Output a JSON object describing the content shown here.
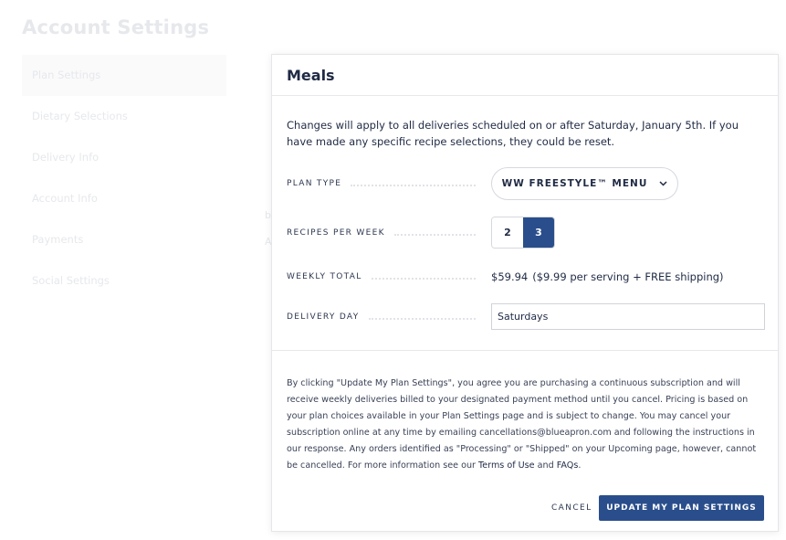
{
  "page": {
    "title": "Account Settings",
    "nav": [
      {
        "label": "Plan Settings",
        "active": true
      },
      {
        "label": "Dietary Selections",
        "active": false
      },
      {
        "label": "Delivery Info",
        "active": false
      },
      {
        "label": "Account Info",
        "active": false
      },
      {
        "label": "Payments",
        "active": false
      },
      {
        "label": "Social Settings",
        "active": false
      }
    ],
    "ghost_text": [
      "b",
      "A"
    ]
  },
  "modal": {
    "title": "Meals",
    "intro": "Changes will apply to all deliveries scheduled on or after Saturday, January 5th. If you have made any specific recipe selections, they could be reset.",
    "plan_type": {
      "label": "PLAN TYPE",
      "value": "WW FREESTYLE™ MENU",
      "icon": "chevron-down-icon"
    },
    "recipes_per_week": {
      "label": "RECIPES PER WEEK",
      "options": [
        "2",
        "3"
      ],
      "selected": "3"
    },
    "weekly_total": {
      "label": "WEEKLY TOTAL",
      "price": "$59.94",
      "detail": "($9.99 per serving + FREE shipping)"
    },
    "delivery_day": {
      "label": "DELIVERY DAY",
      "value": "Saturdays"
    },
    "legal": {
      "text": "By clicking \"Update My Plan Settings\", you agree you are purchasing a continuous subscription and will receive weekly deliveries billed to your designated payment method until you cancel. Pricing is based on your plan choices available in your Plan Settings page and is subject to change. You may cancel your subscription online at any time by emailing cancellations@blueapron.com and following the instructions in our response. Any orders identified as \"Processing\" or \"Shipped\" on your Upcoming page, however, cannot be cancelled. For more information see our ",
      "terms_link": "Terms of Use",
      "and": " and ",
      "faqs_link": "FAQs",
      "end": "."
    },
    "cancel_label": "CANCEL",
    "update_label": "UPDATE MY PLAN SETTINGS",
    "colors": {
      "primary": "#2a4e8c",
      "text": "#1f2a44"
    }
  }
}
